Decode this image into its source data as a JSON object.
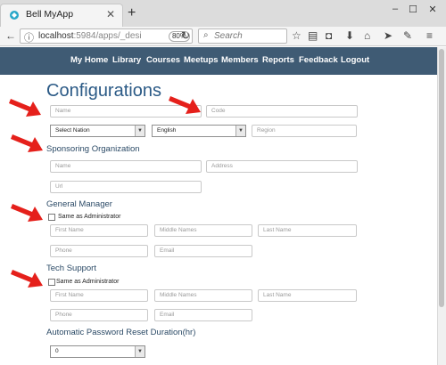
{
  "browser": {
    "tab_title": "Bell MyApp",
    "tab_close": "✕",
    "new_tab": "+",
    "url_host": "localhost",
    "url_rest": ":5984/apps/_desi",
    "zoom": "80%",
    "search_placeholder": "Search",
    "window_controls": [
      "–",
      "☐",
      "✕"
    ],
    "toolbar_icons": [
      "star-icon",
      "reading-list-icon",
      "pocket-icon",
      "download-icon",
      "home-icon",
      "send-icon",
      "extension-icon",
      "menu-icon"
    ]
  },
  "app_nav": {
    "items": [
      "My Home",
      "Library",
      "Courses",
      "Meetups",
      "Members",
      "Reports",
      "Feedback",
      "Logout"
    ]
  },
  "page": {
    "title": "Configurations"
  },
  "config": {
    "name_placeholder": "Name",
    "code_placeholder": "Code",
    "nation_selected": "Select Nation",
    "language_selected": "English",
    "region_placeholder": "Region"
  },
  "sponsor": {
    "title": "Sponsoring Organization",
    "name_placeholder": "Name",
    "address_placeholder": "Address",
    "url_placeholder": "Url"
  },
  "manager": {
    "title": "General Manager",
    "same_as_admin": "Same as Administrator",
    "first_name": "First Name",
    "middle_names": "Middle Names",
    "last_name": "Last Name",
    "phone": "Phone",
    "email": "Email"
  },
  "tech": {
    "title": "Tech Support",
    "same_as_admin": "Same as Administrator",
    "first_name": "First Name",
    "middle_names": "Middle Names",
    "last_name": "Last Name",
    "phone": "Phone",
    "email": "Email"
  },
  "password": {
    "title": "Automatic Password Reset Duration(hr)",
    "selected": "0"
  },
  "colors": {
    "nav_bg": "#3f5b74",
    "title": "#2b5a86",
    "arrow": "#e5201b"
  }
}
